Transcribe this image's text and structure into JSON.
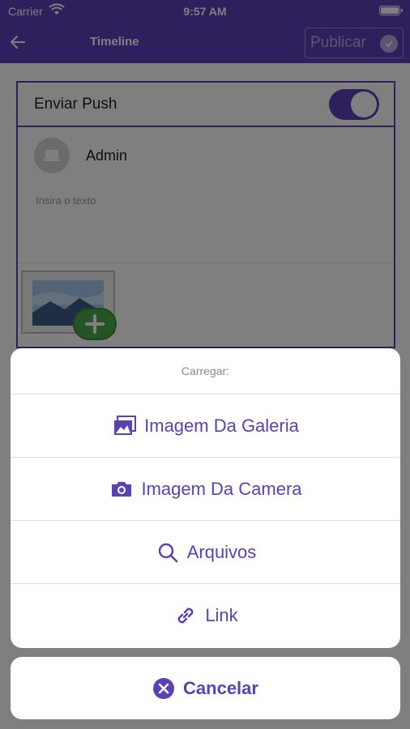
{
  "status_bar": {
    "carrier": "Carrier",
    "time": "9:57 AM"
  },
  "nav": {
    "title": "Timeline",
    "publish_label": "Publicar"
  },
  "post": {
    "push_label": "Enviar Push",
    "push_enabled": true,
    "author_name": "Admin",
    "text_placeholder": "Insira o texto"
  },
  "action_sheet": {
    "header": "Carregar:",
    "items": [
      {
        "label": "Imagem Da Galeria",
        "icon": "gallery-icon"
      },
      {
        "label": "Imagem Da Camera",
        "icon": "camera-icon"
      },
      {
        "label": "Arquivos",
        "icon": "search-icon"
      },
      {
        "label": "Link",
        "icon": "link-icon"
      }
    ],
    "cancel_label": "Cancelar"
  },
  "colors": {
    "accent": "#5b41b8",
    "add_photo": "#4ca84a"
  }
}
